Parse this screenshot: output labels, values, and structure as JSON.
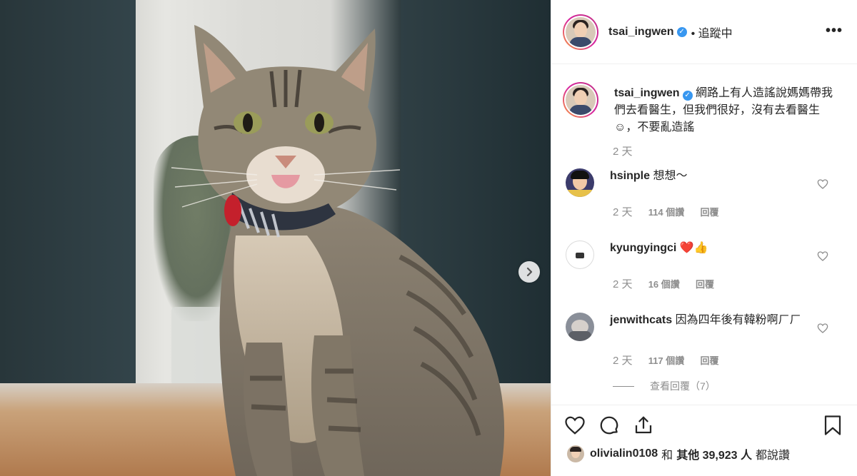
{
  "post": {
    "author": "tsai_ingwen",
    "verified_mark": "✓",
    "follow_status": "• 追蹤中",
    "more_label": "•••"
  },
  "caption": {
    "username": "tsai_ingwen",
    "text": "網路上有人造謠說媽媽帶我們去看醫生，但我們很好，沒有去看醫生☺，不要亂造謠",
    "time": "2 天"
  },
  "comments": [
    {
      "username": "hsinple",
      "text": "想想～",
      "time": "2 天",
      "likes": "114 個讚",
      "reply": "回覆"
    },
    {
      "username": "kyungyingci",
      "text": "❤️👍",
      "time": "2 天",
      "likes": "16 個讚",
      "reply": "回覆"
    },
    {
      "username": "jenwithcats",
      "text": "因為四年後有韓粉啊ㄏㄏ",
      "time": "2 天",
      "likes": "117 個讚",
      "reply": "回覆"
    }
  ],
  "view_replies": "查看回覆（7）",
  "likes_line": {
    "user": "olivialin0108",
    "connector": "和",
    "others": "其他 39,923 人",
    "suffix": "都說讚"
  },
  "icons": {
    "next": "chevron-right-icon",
    "like": "heart-icon",
    "comment": "comment-bubble-icon",
    "share": "share-icon",
    "save": "bookmark-icon"
  },
  "colors": {
    "accent": "#3897f0",
    "heart": "#ed4956",
    "text": "#262626",
    "muted": "#8e8e8e"
  }
}
